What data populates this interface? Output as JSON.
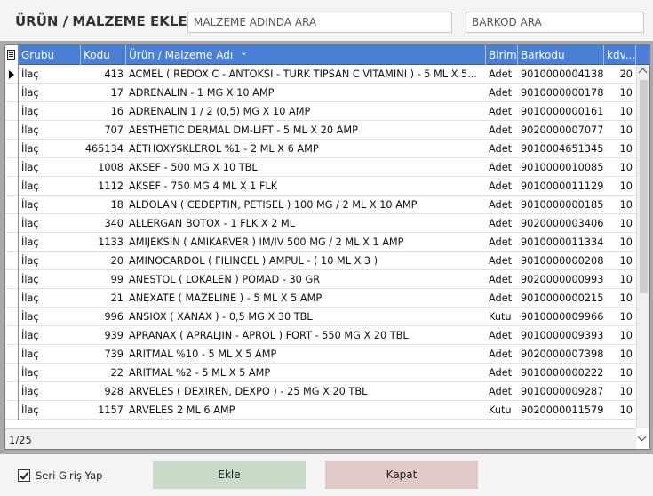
{
  "header": {
    "title": "ÜRÜN / MALZEME EKLE",
    "search_name_placeholder": "MALZEME ADINDA ARA",
    "search_barcode_placeholder": "BARKOD ARA"
  },
  "grid": {
    "columns": {
      "grubu": "Grubu",
      "kodu": "Kodu",
      "name": "Ürün / Malzeme Adı",
      "birim": "Birim",
      "barkod": "Barkodu",
      "kdv": "kdv..."
    },
    "sort_indicator": "⌄",
    "rows": [
      {
        "grubu": "İlaç",
        "kodu": "413",
        "name": "ACMEL ( REDOX C - ANTOKSI -  TURK TIPSAN C VITAMINI ) - 5 ML X 5...",
        "birim": "Adet",
        "barkod": "9010000004138",
        "kdv": "20"
      },
      {
        "grubu": "İlaç",
        "kodu": "17",
        "name": "ADRENALIN - 1 MG X 10 AMP",
        "birim": "Adet",
        "barkod": "9010000000178",
        "kdv": "10"
      },
      {
        "grubu": "İlaç",
        "kodu": "16",
        "name": "ADRENALIN 1 / 2 (0,5) MG X 10 AMP",
        "birim": "Adet",
        "barkod": "9010000000161",
        "kdv": "10"
      },
      {
        "grubu": "İlaç",
        "kodu": "707",
        "name": "AESTHETIC DERMAL DM-LIFT - 5 ML X 20 AMP",
        "birim": "Adet",
        "barkod": "9020000007077",
        "kdv": "10"
      },
      {
        "grubu": "İlaç",
        "kodu": "465134",
        "name": "AETHOXYSKLEROL %1 - 2 ML X 6 AMP",
        "birim": "Adet",
        "barkod": "9010004651345",
        "kdv": "10"
      },
      {
        "grubu": "İlaç",
        "kodu": "1008",
        "name": "AKSEF - 500 MG X  10 TBL",
        "birim": "Adet",
        "barkod": "9010000010085",
        "kdv": "10"
      },
      {
        "grubu": "İlaç",
        "kodu": "1112",
        "name": "AKSEF - 750 MG 4 ML X 1 FLK",
        "birim": "Adet",
        "barkod": "9010000011129",
        "kdv": "10"
      },
      {
        "grubu": "İlaç",
        "kodu": "18",
        "name": "ALDOLAN ( CEDEPTIN, PETISEL ) 100 MG / 2 ML X 10  AMP",
        "birim": "Adet",
        "barkod": "9010000000185",
        "kdv": "10"
      },
      {
        "grubu": "İlaç",
        "kodu": "340",
        "name": "ALLERGAN BOTOX - 1 FLK X 2 ML",
        "birim": "Adet",
        "barkod": "9020000003406",
        "kdv": "10"
      },
      {
        "grubu": "İlaç",
        "kodu": "1133",
        "name": "AMIJEKSIN ( AMIKARVER ) IM/IV 500 MG / 2 ML X 1 AMP",
        "birim": "Adet",
        "barkod": "9010000011334",
        "kdv": "10"
      },
      {
        "grubu": "İlaç",
        "kodu": "20",
        "name": "AMINOCARDOL ( FILINCEL ) AMPUL - ( 10 ML X 3 )",
        "birim": "Adet",
        "barkod": "9010000000208",
        "kdv": "10"
      },
      {
        "grubu": "İlaç",
        "kodu": "99",
        "name": "ANESTOL ( LOKALEN ) POMAD - 30 GR",
        "birim": "Adet",
        "barkod": "9020000000993",
        "kdv": "10"
      },
      {
        "grubu": "İlaç",
        "kodu": "21",
        "name": "ANEXATE ( MAZELINE ) - 5 ML X 5 AMP",
        "birim": "Adet",
        "barkod": "9010000000215",
        "kdv": "10"
      },
      {
        "grubu": "İlaç",
        "kodu": "996",
        "name": "ANSIOX ( XANAX ) - 0,5 MG X 30 TBL",
        "birim": "Kutu",
        "barkod": "9010000009966",
        "kdv": "10"
      },
      {
        "grubu": "İlaç",
        "kodu": "939",
        "name": "APRANAX ( APRALJIN - APROL ) FORT - 550 MG X 20 TBL",
        "birim": "Adet",
        "barkod": "9010000009393",
        "kdv": "10"
      },
      {
        "grubu": "İlaç",
        "kodu": "739",
        "name": "ARITMAL %10 - 5 ML X 5 AMP",
        "birim": "Adet",
        "barkod": "9020000007398",
        "kdv": "10"
      },
      {
        "grubu": "İlaç",
        "kodu": "22",
        "name": "ARITMAL %2 - 5 ML X 5 AMP",
        "birim": "Adet",
        "barkod": "9010000000222",
        "kdv": "10"
      },
      {
        "grubu": "İlaç",
        "kodu": "928",
        "name": "ARVELES ( DEXIREN, DEXPO ) - 25 MG X 20 TBL",
        "birim": "Adet",
        "barkod": "9010000009287",
        "kdv": "10"
      },
      {
        "grubu": "İlaç",
        "kodu": "1157",
        "name": "ARVELES 2 ML 6 AMP",
        "birim": "Kutu",
        "barkod": "9020000011579",
        "kdv": "10"
      }
    ],
    "selected_row": 0,
    "page_indicator": "1/25"
  },
  "bottom": {
    "checkbox_label": "Seri Giriş Yap",
    "checkbox_checked": true,
    "add_button": "Ekle",
    "close_button": "Kapat"
  },
  "colors": {
    "header_blue": "#4a7fd8",
    "add_green": "#c9dcc9",
    "close_red": "#e3c8c8"
  }
}
